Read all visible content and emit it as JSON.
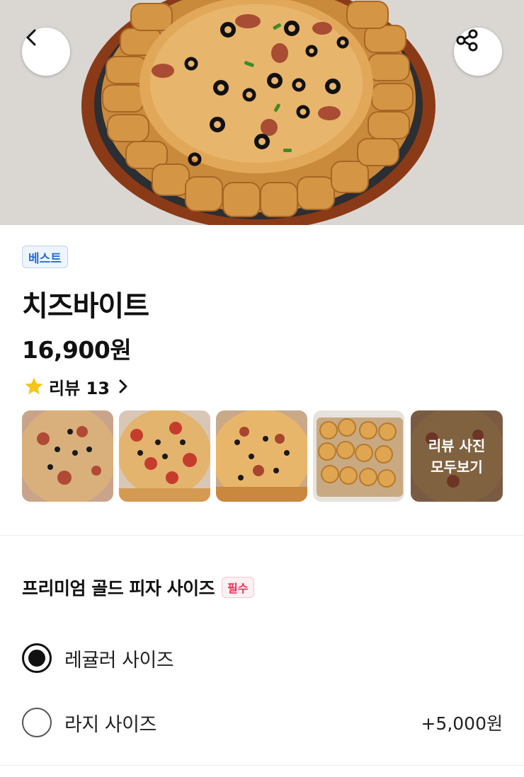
{
  "header": {
    "back_icon": "chevron-left-icon",
    "share_icon": "share-icon"
  },
  "product": {
    "badge": "베스트",
    "name": "치즈바이트",
    "price": "16,900원",
    "review": {
      "star_icon": "star-icon",
      "label": "리뷰 13",
      "star_color": "#f5c518"
    }
  },
  "review_photos": {
    "more_label": "리뷰 사진\n모두보기"
  },
  "options": {
    "group_title": "프리미엄 골드 피자 사이즈",
    "required_badge": "필수",
    "items": [
      {
        "label": "레귤러 사이즈",
        "price": "",
        "selected": true
      },
      {
        "label": "라지 사이즈",
        "price": "+5,000원",
        "selected": false
      }
    ]
  },
  "colors": {
    "best_badge": "#2a6fd6",
    "required_badge": "#e5345a"
  }
}
